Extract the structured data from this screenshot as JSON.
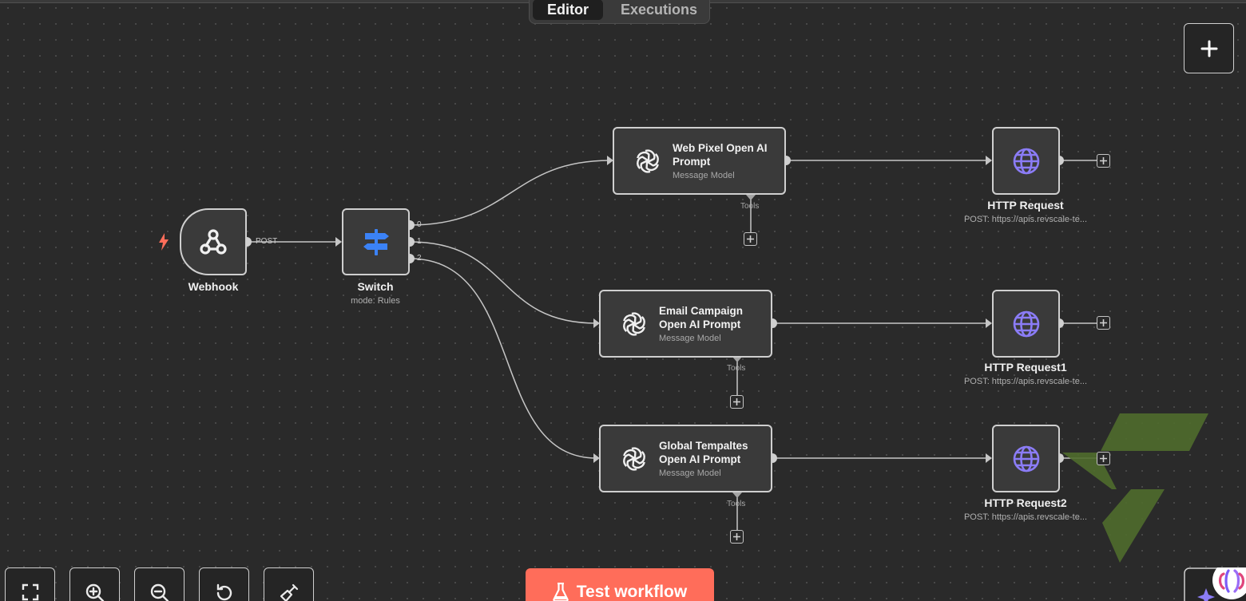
{
  "tabs": [
    {
      "label": "Editor",
      "active": true
    },
    {
      "label": "Executions",
      "active": false
    }
  ],
  "nodes": {
    "webhook": {
      "label": "Webhook",
      "output_label": "POST"
    },
    "switch": {
      "label": "Switch",
      "subtitle": "mode: Rules",
      "outputs": [
        "0",
        "1",
        "2"
      ]
    },
    "ai_nodes": [
      {
        "title_line1": "Web Pixel Open AI",
        "title_line2": "Prompt",
        "subtitle": "Message Model",
        "tools_label": "Tools"
      },
      {
        "title_line1": "Email Campaign",
        "title_line2": "Open AI Prompt",
        "subtitle": "Message Model",
        "tools_label": "Tools"
      },
      {
        "title_line1": "Global Tempaltes",
        "title_line2": "Open AI Prompt",
        "subtitle": "Message Model",
        "tools_label": "Tools"
      }
    ],
    "http_nodes": [
      {
        "label": "HTTP Request",
        "subtitle": "POST: https://apis.revscale-te..."
      },
      {
        "label": "HTTP Request1",
        "subtitle": "POST: https://apis.revscale-te..."
      },
      {
        "label": "HTTP Request2",
        "subtitle": "POST: https://apis.revscale-te..."
      }
    ]
  },
  "toolbar": {
    "test_workflow_label": "Test workflow"
  },
  "icons": {
    "add_node": "plus-icon",
    "controls": [
      "fit-view-icon",
      "zoom-in-icon",
      "zoom-out-icon",
      "reset-zoom-icon",
      "tidy-up-icon"
    ],
    "trigger": "lightning-icon",
    "webhook": "webhook-icon",
    "switch": "signpost-icon",
    "ai": "openai-icon",
    "http": "globe-icon",
    "assistant": "ai-assistant-icon"
  },
  "colors": {
    "canvas": "#2a2a2a",
    "node_bg": "#3a3a3a",
    "node_border": "#cfcfcf",
    "accent": "#ff6d5a",
    "globe": "#8b7cf6",
    "switch_icon": "#3b82f6",
    "watermark": "#4f6b2c"
  }
}
